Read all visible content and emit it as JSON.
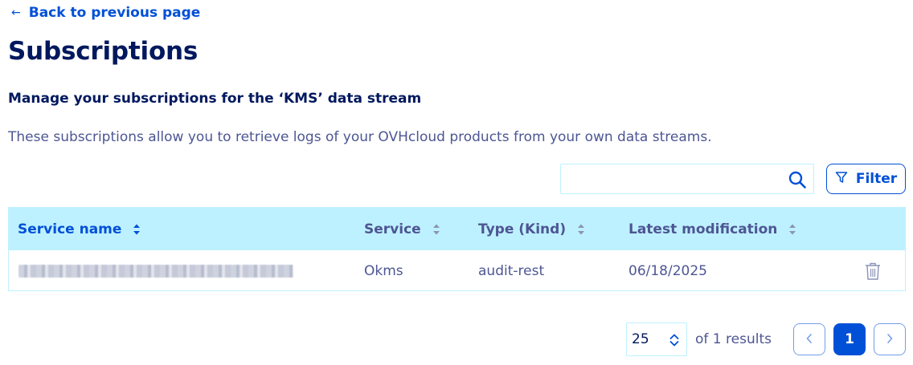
{
  "nav": {
    "back_label": "Back to previous page"
  },
  "header": {
    "title": "Subscriptions",
    "subtitle": "Manage your subscriptions for the ‘KMS’ data stream",
    "description": "These subscriptions allow you to retrieve logs of your OVHcloud products from your own data streams."
  },
  "toolbar": {
    "search_value": "",
    "search_placeholder": "",
    "filter_label": "Filter"
  },
  "table": {
    "columns": [
      "Service name",
      "Service",
      "Type (Kind)",
      "Latest modification"
    ],
    "rows": [
      {
        "service": "Okms",
        "type": "audit-rest",
        "modified": "06/18/2025"
      }
    ]
  },
  "pagination": {
    "page_size": "25",
    "results_text": "of 1 results",
    "current_page": "1"
  },
  "colors": {
    "primary": "#0050d7",
    "heading": "#00185e",
    "text": "#4d5693",
    "header_bg": "#bef1ff"
  },
  "icons": {
    "back": "arrow-left-icon",
    "search": "search-icon",
    "filter": "filter-icon",
    "sort": "sort-icon",
    "delete": "trash-icon",
    "select": "chevron-up-down-icon",
    "prev": "chevron-left-icon",
    "next": "chevron-right-icon"
  }
}
